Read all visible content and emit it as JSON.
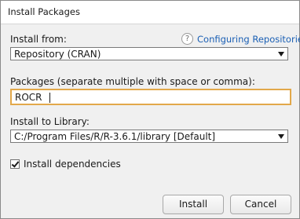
{
  "window": {
    "title": "Install Packages"
  },
  "install_from": {
    "label": "Install from:",
    "value": "Repository (CRAN)"
  },
  "help": {
    "icon_glyph": "?",
    "link_text": "Configuring Repositories",
    "link_color": "#1a5fb4"
  },
  "packages": {
    "label": "Packages (separate multiple with space or comma):",
    "value": "ROCR"
  },
  "library": {
    "label": "Install to Library:",
    "value": "C:/Program Files/R/R-3.6.1/library [Default]"
  },
  "dependencies": {
    "label": "Install dependencies",
    "checked": true
  },
  "buttons": {
    "install": "Install",
    "cancel": "Cancel"
  },
  "colors": {
    "focus_border": "#e2a84a",
    "dialog_bg": "#f0f0f0"
  }
}
